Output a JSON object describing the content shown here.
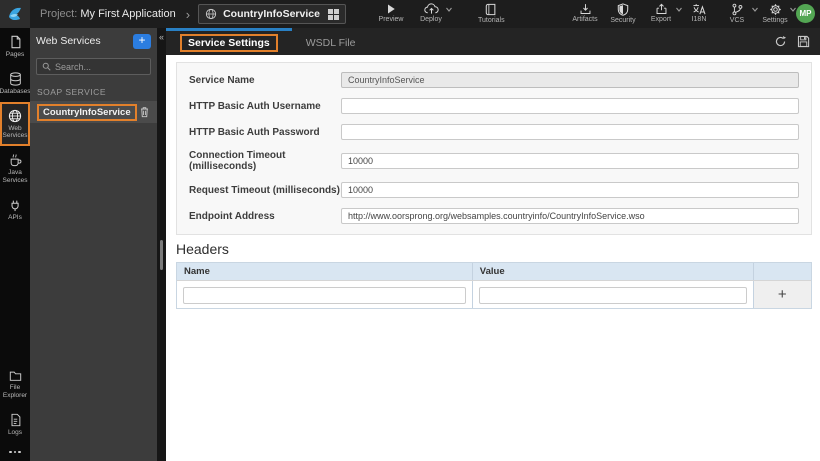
{
  "topbar": {
    "project_label": "Project:",
    "project_name": "My First Application",
    "breadcrumb": {
      "service_name": "CountryInfoService"
    },
    "actions": [
      {
        "label": "Preview",
        "icon": "play-icon",
        "has_dropdown": false
      },
      {
        "label": "Deploy",
        "icon": "cloud-up-icon",
        "has_dropdown": true
      },
      {
        "label": "Tutorials",
        "icon": "book-icon",
        "has_dropdown": false
      },
      {
        "label": "Artifacts",
        "icon": "download-icon",
        "has_dropdown": false
      },
      {
        "label": "Security",
        "icon": "shield-icon",
        "has_dropdown": false
      },
      {
        "label": "Export",
        "icon": "upload-icon",
        "has_dropdown": true
      },
      {
        "label": "I18N",
        "icon": "translate-icon",
        "has_dropdown": false
      },
      {
        "label": "VCS",
        "icon": "branch-icon",
        "has_dropdown": true
      },
      {
        "label": "Settings",
        "icon": "gear-icon",
        "has_dropdown": true
      }
    ],
    "avatar_initials": "MP"
  },
  "sidebar": {
    "items": [
      {
        "label": "Pages",
        "icon": "page-icon",
        "active": false
      },
      {
        "label": "Databases",
        "icon": "database-icon",
        "active": false
      },
      {
        "label": "Web Services",
        "icon": "globe-icon",
        "active": true
      },
      {
        "label": "Java Services",
        "icon": "coffee-icon",
        "active": false
      },
      {
        "label": "APIs",
        "icon": "api-plug-icon",
        "active": false
      }
    ],
    "bottom_items": [
      {
        "label": "File Explorer",
        "icon": "folder-icon"
      },
      {
        "label": "Logs",
        "icon": "log-file-icon"
      }
    ],
    "more_icon": "ellipsis-icon"
  },
  "panel": {
    "title": "Web Services",
    "add_button": "+",
    "collapse_arrow": "«",
    "search": {
      "placeholder": "Search..."
    },
    "section_label": "SOAP SERVICE",
    "services": [
      {
        "name": "CountryInfoService"
      }
    ]
  },
  "tabs": [
    {
      "label": "Service Settings",
      "active": true
    },
    {
      "label": "WSDL File",
      "active": false
    }
  ],
  "form": {
    "fields": [
      {
        "label": "Service Name",
        "value": "CountryInfoService",
        "disabled": true
      },
      {
        "label": "HTTP Basic Auth Username",
        "value": ""
      },
      {
        "label": "HTTP Basic Auth Password",
        "value": ""
      },
      {
        "label": "Connection Timeout (milliseconds)",
        "value": "10000"
      },
      {
        "label": "Request Timeout (milliseconds)",
        "value": "10000"
      },
      {
        "label": "Endpoint Address",
        "value": "http://www.oorsprong.org/websamples.countryinfo/CountryInfoService.wso"
      }
    ]
  },
  "headers_section": {
    "title": "Headers",
    "columns": [
      "Name",
      "Value"
    ],
    "add_row_button": "+"
  },
  "colors": {
    "highlight_orange": "#e2802b",
    "active_tab_blue": "#2980c4",
    "add_button_blue": "#2b7de0",
    "avatar_green": "#53a653",
    "table_header_blue": "#d9e6f2"
  }
}
